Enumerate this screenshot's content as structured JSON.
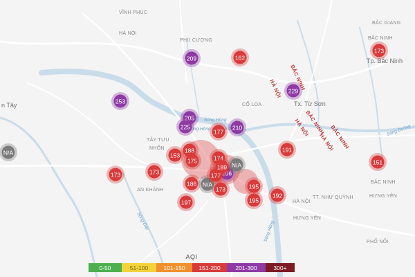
{
  "map": {
    "labels": {
      "vinh_phuc": "VĨNH PHÚC",
      "ha_noi_nw": "HÀ NỘI",
      "phu_cuong": "PHÙ CƯƠNG",
      "bac_giang": "BẮC GIANG",
      "bac_ninh_top": "BẮC NINH",
      "tp_bac_ninh": "Tp. Bắc Ninh",
      "ha_noi_ne": "HÀ NỘI",
      "bac_ninh_mid": "BẮC NINH",
      "tx_tu_son": "Tx. Từ Sơn",
      "co_loa": "CỔ LOA",
      "bac_ninh_e1": "BẮC NINH",
      "ha_noi_e1": "HÀ NỘI",
      "bac_ninh_e2": "BẮC NINH",
      "ha_noi_e2": "HÀ NỘI",
      "song_duong": "Sông Đuống",
      "song_hong_n": "Sông Hồng",
      "station_overlay": "Sông Hồng...phone 2",
      "tay_tuu": "TÂY TỰU",
      "nhon": "NHỔN",
      "an_khanh": "AN KHÁNH",
      "bac_ninh_se": "BẮC NINH",
      "ha_noi_s": "HÀ NỘI",
      "nhu_quynh": "TT. NHƯ QUỲNH",
      "hung_yen_1": "HƯNG YÊN",
      "hung_yen_2": "HƯNG YÊN",
      "pho_noi": "PHỐ NỐI",
      "son_tay": "n Tây",
      "song_hong_s": "Sông Hồng",
      "song_day": "Sông Đáy"
    },
    "stations": [
      {
        "value": "173",
        "color": "#d93a3a"
      },
      {
        "value": "209",
        "color": "#8e3aa4"
      },
      {
        "value": "162",
        "color": "#d93a3a"
      },
      {
        "value": "229",
        "color": "#8e3aa4"
      },
      {
        "value": "253",
        "color": "#8e3aa4"
      },
      {
        "value": "205",
        "color": "#8e3aa4"
      },
      {
        "value": "225",
        "color": "#8e3aa4"
      },
      {
        "value": "177",
        "color": "#d93a3a"
      },
      {
        "value": "210",
        "color": "#8e3aa4"
      },
      {
        "value": "N/A",
        "color": "#7b7b7b"
      },
      {
        "value": "188",
        "color": "#d93a3a"
      },
      {
        "value": "153",
        "color": "#d93a3a"
      },
      {
        "value": "191",
        "color": "#d93a3a"
      },
      {
        "value": "151",
        "color": "#d93a3a"
      },
      {
        "value": "175",
        "color": "#d93a3a"
      },
      {
        "value": "173",
        "color": "#d93a3a"
      },
      {
        "value": "173",
        "color": "#d93a3a"
      },
      {
        "value": "186",
        "color": "#d93a3a"
      },
      {
        "value": "N/A",
        "color": "#7b7b7b"
      },
      {
        "value": "173",
        "color": "#d93a3a"
      },
      {
        "value": "206",
        "color": "#8e3aa4"
      },
      {
        "value": "N/A",
        "color": "#7b7b7b"
      },
      {
        "value": "195",
        "color": "#d93a3a"
      },
      {
        "value": "195",
        "color": "#d93a3a"
      },
      {
        "value": "192",
        "color": "#d93a3a"
      },
      {
        "value": "197",
        "color": "#d93a3a"
      },
      {
        "value": "177",
        "color": "#d93a3a"
      },
      {
        "value": "174",
        "color": "#d93a3a"
      },
      {
        "value": "189",
        "color": "#d93a3a"
      }
    ]
  },
  "legend": {
    "title": "AQI",
    "segments": [
      {
        "label": "0-50",
        "color": "#4caf50"
      },
      {
        "label": "51-100",
        "color": "#f2d33c"
      },
      {
        "label": "101-150",
        "color": "#f0902c"
      },
      {
        "label": "151-200",
        "color": "#d93a3a"
      },
      {
        "label": "201-300",
        "color": "#8e3aa4"
      },
      {
        "label": "300+",
        "color": "#7d1a24"
      }
    ]
  }
}
